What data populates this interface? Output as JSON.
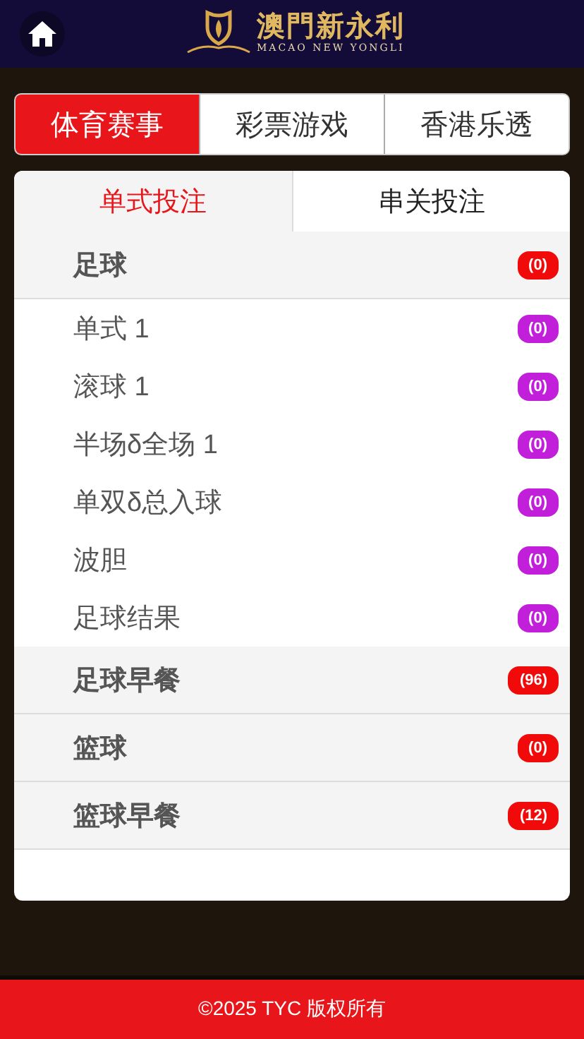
{
  "header": {
    "logo_title": "澳門新永利",
    "logo_subtitle": "MACAO NEW YONGLI"
  },
  "tabs": [
    {
      "label": "体育赛事",
      "selected": true
    },
    {
      "label": "彩票游戏",
      "selected": false
    },
    {
      "label": "香港乐透",
      "selected": false
    }
  ],
  "subtabs": [
    {
      "label": "单式投注",
      "selected": true
    },
    {
      "label": "串关投注",
      "selected": false
    }
  ],
  "groups": [
    {
      "label": "足球",
      "count": "(0)",
      "children": [
        {
          "label": "单式 1",
          "count": "(0)"
        },
        {
          "label": "滚球 1",
          "count": "(0)"
        },
        {
          "label": "半场δ全场 1",
          "count": "(0)"
        },
        {
          "label": "单双δ总入球",
          "count": "(0)"
        },
        {
          "label": "波胆",
          "count": "(0)"
        },
        {
          "label": "足球结果",
          "count": "(0)"
        }
      ]
    },
    {
      "label": "足球早餐",
      "count": "(96)"
    },
    {
      "label": "篮球",
      "count": "(0)"
    },
    {
      "label": "篮球早餐",
      "count": "(12)"
    }
  ],
  "footer": "©2025 TYC 版权所有"
}
